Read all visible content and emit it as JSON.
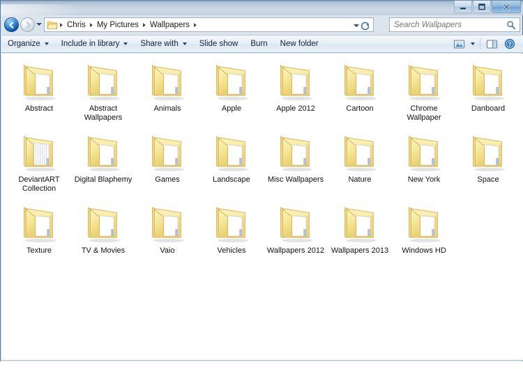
{
  "window": {
    "title": "",
    "controls": {
      "minimize": "Minimize",
      "maximize": "Maximize",
      "close": "Close"
    },
    "border_color": "#4a79a8",
    "titlebar_gradient_top": "#6e8aa8",
    "titlebar_gradient_bottom": "#c2cfdd"
  },
  "nav": {
    "back_label": "Back",
    "forward_label": "Forward",
    "history_label": "Recent pages",
    "breadcrumb": [
      {
        "label": "Chris"
      },
      {
        "label": "My Pictures"
      },
      {
        "label": "Wallpapers"
      }
    ],
    "address_dropdown_label": "Previous locations",
    "refresh_label": "Refresh"
  },
  "search": {
    "placeholder": "Search Wallpapers",
    "value": "",
    "icon": "search-icon"
  },
  "toolbar": {
    "items": [
      {
        "label": "Organize",
        "has_caret": true
      },
      {
        "label": "Include in library",
        "has_caret": true
      },
      {
        "label": "Share with",
        "has_caret": true
      },
      {
        "label": "Slide show",
        "has_caret": false
      },
      {
        "label": "Burn",
        "has_caret": false
      },
      {
        "label": "New folder",
        "has_caret": false
      }
    ],
    "right_icons": [
      {
        "name": "change-view-icon",
        "label": "Change your view"
      },
      {
        "name": "view-dropdown-icon",
        "label": "More options"
      },
      {
        "name": "preview-pane-icon",
        "label": "Show the preview pane"
      },
      {
        "name": "help-icon",
        "label": "Get help"
      }
    ]
  },
  "content": {
    "view_mode": "medium-icons",
    "columns": 8,
    "items": [
      {
        "name": "Abstract",
        "type": "folder",
        "style": "single"
      },
      {
        "name": "Abstract Wallpapers",
        "type": "folder",
        "style": "single"
      },
      {
        "name": "Animals",
        "type": "folder",
        "style": "single"
      },
      {
        "name": "Apple",
        "type": "folder",
        "style": "single"
      },
      {
        "name": "Apple 2012",
        "type": "folder",
        "style": "single"
      },
      {
        "name": "Cartoon",
        "type": "folder",
        "style": "single"
      },
      {
        "name": "Chrome Wallpaper",
        "type": "folder",
        "style": "single"
      },
      {
        "name": "Danboard",
        "type": "folder",
        "style": "single"
      },
      {
        "name": "DeviantART Collection",
        "type": "folder",
        "style": "stacked"
      },
      {
        "name": "Digital Blaphemy",
        "type": "folder",
        "style": "single"
      },
      {
        "name": "Games",
        "type": "folder",
        "style": "single"
      },
      {
        "name": "Landscape",
        "type": "folder",
        "style": "single"
      },
      {
        "name": "Misc Wallpapers",
        "type": "folder",
        "style": "single"
      },
      {
        "name": "Nature",
        "type": "folder",
        "style": "single"
      },
      {
        "name": "New York",
        "type": "folder",
        "style": "single"
      },
      {
        "name": "Space",
        "type": "folder",
        "style": "single"
      },
      {
        "name": "Texture",
        "type": "folder",
        "style": "single"
      },
      {
        "name": "TV & Movies",
        "type": "folder",
        "style": "single"
      },
      {
        "name": "Vaio",
        "type": "folder",
        "style": "single"
      },
      {
        "name": "Vehicles",
        "type": "folder",
        "style": "single"
      },
      {
        "name": "Wallpapers 2012",
        "type": "folder",
        "style": "single"
      },
      {
        "name": "Wallpapers 2013",
        "type": "folder",
        "style": "single"
      },
      {
        "name": "Windows HD",
        "type": "folder",
        "style": "single"
      }
    ]
  },
  "colors": {
    "folder_light": "#fdf4bf",
    "folder_mid": "#f4e18f",
    "folder_dark": "#e5c963",
    "folder_edge": "#d4b44f",
    "window_bg": "#ffffff",
    "accent_blue": "#2d7ac4"
  }
}
